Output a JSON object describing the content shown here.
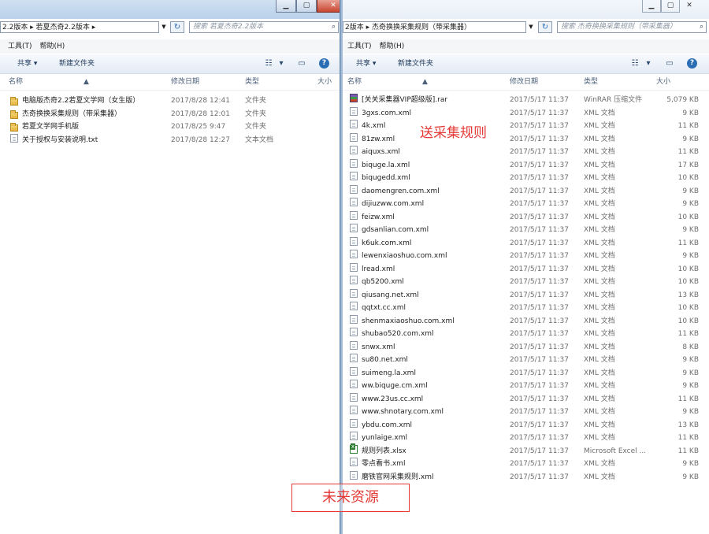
{
  "left": {
    "breadcrumb": "2.2版本  ▸  若夏杰奇2.2版本  ▸",
    "search_placeholder": "搜索 若夏杰奇2.2版本",
    "menu": [
      "工具(T)",
      "帮助(H)"
    ],
    "toolbar": {
      "share": "共享 ▾",
      "new_folder": "新建文件夹"
    },
    "columns": {
      "name": "名称",
      "date": "修改日期",
      "type": "类型",
      "size": "大小"
    },
    "rows": [
      {
        "icon": "folder-icon",
        "name": "电脑版杰奇2.2若夏文学网（女生版）",
        "date": "2017/8/28 12:41",
        "type": "文件夹",
        "size": ""
      },
      {
        "icon": "folder-icon",
        "name": "杰奇换换采集规则（带采集器）",
        "date": "2017/8/28 12:01",
        "type": "文件夹",
        "size": ""
      },
      {
        "icon": "folder-icon",
        "name": "若夏文学网手机版",
        "date": "2017/8/25 9:47",
        "type": "文件夹",
        "size": ""
      },
      {
        "icon": "text-file-icon",
        "name": "关于授权与安装说明.txt",
        "date": "2017/8/28 12:27",
        "type": "文本文档",
        "size": ""
      }
    ]
  },
  "right": {
    "breadcrumb": "2版本  ▸  杰奇换换采集规则（带采集器）",
    "search_placeholder": "搜索 杰奇换换采集规则（带采集器）",
    "menu": [
      "工具(T)",
      "帮助(H)"
    ],
    "toolbar": {
      "share": "共享 ▾",
      "new_folder": "新建文件夹"
    },
    "columns": {
      "name": "名称",
      "date": "修改日期",
      "type": "类型",
      "size": "大小"
    },
    "rows": [
      {
        "icon": "rar-icon",
        "name": "[关关采集器VIP超级版].rar",
        "date": "2017/5/17 11:37",
        "type": "WinRAR 压缩文件",
        "size": "5,079 KB"
      },
      {
        "icon": "xml-file-icon",
        "name": "3gxs.com.xml",
        "date": "2017/5/17 11:37",
        "type": "XML 文档",
        "size": "9 KB"
      },
      {
        "icon": "xml-file-icon",
        "name": "4k.xml",
        "date": "2017/5/17 11:37",
        "type": "XML 文档",
        "size": "11 KB"
      },
      {
        "icon": "xml-file-icon",
        "name": "81zw.xml",
        "date": "2017/5/17 11:37",
        "type": "XML 文档",
        "size": "9 KB"
      },
      {
        "icon": "xml-file-icon",
        "name": "aiquxs.xml",
        "date": "2017/5/17 11:37",
        "type": "XML 文档",
        "size": "11 KB"
      },
      {
        "icon": "xml-file-icon",
        "name": "biquge.la.xml",
        "date": "2017/5/17 11:37",
        "type": "XML 文档",
        "size": "17 KB"
      },
      {
        "icon": "xml-file-icon",
        "name": "biqugedd.xml",
        "date": "2017/5/17 11:37",
        "type": "XML 文档",
        "size": "10 KB"
      },
      {
        "icon": "xml-file-icon",
        "name": "daomengren.com.xml",
        "date": "2017/5/17 11:37",
        "type": "XML 文档",
        "size": "9 KB"
      },
      {
        "icon": "xml-file-icon",
        "name": "dijiuzww.com.xml",
        "date": "2017/5/17 11:37",
        "type": "XML 文档",
        "size": "9 KB"
      },
      {
        "icon": "xml-file-icon",
        "name": "feizw.xml",
        "date": "2017/5/17 11:37",
        "type": "XML 文档",
        "size": "10 KB"
      },
      {
        "icon": "xml-file-icon",
        "name": "gdsanlian.com.xml",
        "date": "2017/5/17 11:37",
        "type": "XML 文档",
        "size": "9 KB"
      },
      {
        "icon": "xml-file-icon",
        "name": "k6uk.com.xml",
        "date": "2017/5/17 11:37",
        "type": "XML 文档",
        "size": "11 KB"
      },
      {
        "icon": "xml-file-icon",
        "name": "lewenxiaoshuo.com.xml",
        "date": "2017/5/17 11:37",
        "type": "XML 文档",
        "size": "9 KB"
      },
      {
        "icon": "xml-file-icon",
        "name": "lread.xml",
        "date": "2017/5/17 11:37",
        "type": "XML 文档",
        "size": "10 KB"
      },
      {
        "icon": "xml-file-icon",
        "name": "qb5200.xml",
        "date": "2017/5/17 11:37",
        "type": "XML 文档",
        "size": "10 KB"
      },
      {
        "icon": "xml-file-icon",
        "name": "qiusang.net.xml",
        "date": "2017/5/17 11:37",
        "type": "XML 文档",
        "size": "13 KB"
      },
      {
        "icon": "xml-file-icon",
        "name": "qqtxt.cc.xml",
        "date": "2017/5/17 11:37",
        "type": "XML 文档",
        "size": "10 KB"
      },
      {
        "icon": "xml-file-icon",
        "name": "shenmaxiaoshuo.com.xml",
        "date": "2017/5/17 11:37",
        "type": "XML 文档",
        "size": "10 KB"
      },
      {
        "icon": "xml-file-icon",
        "name": "shubao520.com.xml",
        "date": "2017/5/17 11:37",
        "type": "XML 文档",
        "size": "11 KB"
      },
      {
        "icon": "xml-file-icon",
        "name": "snwx.xml",
        "date": "2017/5/17 11:37",
        "type": "XML 文档",
        "size": "8 KB"
      },
      {
        "icon": "xml-file-icon",
        "name": "su80.net.xml",
        "date": "2017/5/17 11:37",
        "type": "XML 文档",
        "size": "9 KB"
      },
      {
        "icon": "xml-file-icon",
        "name": "suimeng.la.xml",
        "date": "2017/5/17 11:37",
        "type": "XML 文档",
        "size": "9 KB"
      },
      {
        "icon": "xml-file-icon",
        "name": "ww.biquge.cm.xml",
        "date": "2017/5/17 11:37",
        "type": "XML 文档",
        "size": "9 KB"
      },
      {
        "icon": "xml-file-icon",
        "name": "www.23us.cc.xml",
        "date": "2017/5/17 11:37",
        "type": "XML 文档",
        "size": "11 KB"
      },
      {
        "icon": "xml-file-icon",
        "name": "www.shnotary.com.xml",
        "date": "2017/5/17 11:37",
        "type": "XML 文档",
        "size": "9 KB"
      },
      {
        "icon": "xml-file-icon",
        "name": "ybdu.com.xml",
        "date": "2017/5/17 11:37",
        "type": "XML 文档",
        "size": "13 KB"
      },
      {
        "icon": "xml-file-icon",
        "name": "yunlaige.xml",
        "date": "2017/5/17 11:37",
        "type": "XML 文档",
        "size": "11 KB"
      },
      {
        "icon": "xlsx-file-icon",
        "name": "规则列表.xlsx",
        "date": "2017/5/17 11:37",
        "type": "Microsoft Excel ...",
        "size": "11 KB"
      },
      {
        "icon": "xml-file-icon",
        "name": "零点看书.xml",
        "date": "2017/5/17 11:37",
        "type": "XML 文档",
        "size": "9 KB"
      },
      {
        "icon": "xml-file-icon",
        "name": "磨铁官网采集规则.xml",
        "date": "2017/5/17 11:37",
        "type": "XML 文档",
        "size": "9 KB"
      }
    ]
  },
  "annotation": "送采集规则",
  "watermark": "未来资源",
  "colors": {
    "annotation": "#e53935",
    "divider": "#7b9bbf"
  }
}
